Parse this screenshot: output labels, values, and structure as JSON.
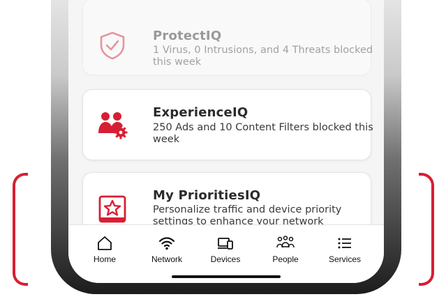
{
  "cards": [
    {
      "title": "ProtectIQ",
      "desc": "1 Virus, 0 Intrusions, and 4 Threats blocked this week",
      "icon": "shield-check-icon"
    },
    {
      "title": "ExperienceIQ",
      "desc": "250 Ads and 10 Content Filters blocked this week",
      "icon": "people-gear-icon"
    },
    {
      "title": "My PrioritiesIQ",
      "desc": "Personalize traffic and device priority settings to enhance your network performance",
      "icon": "star-flag-icon"
    }
  ],
  "nav": [
    {
      "label": "Home",
      "icon": "home-icon"
    },
    {
      "label": "Network",
      "icon": "wifi-icon"
    },
    {
      "label": "Devices",
      "icon": "devices-icon"
    },
    {
      "label": "People",
      "icon": "people-icon"
    },
    {
      "label": "Services",
      "icon": "list-icon"
    }
  ],
  "colors": {
    "accent": "#d71f34",
    "card_bg": "#ffffff",
    "screen_bg": "#f5f5f5"
  }
}
